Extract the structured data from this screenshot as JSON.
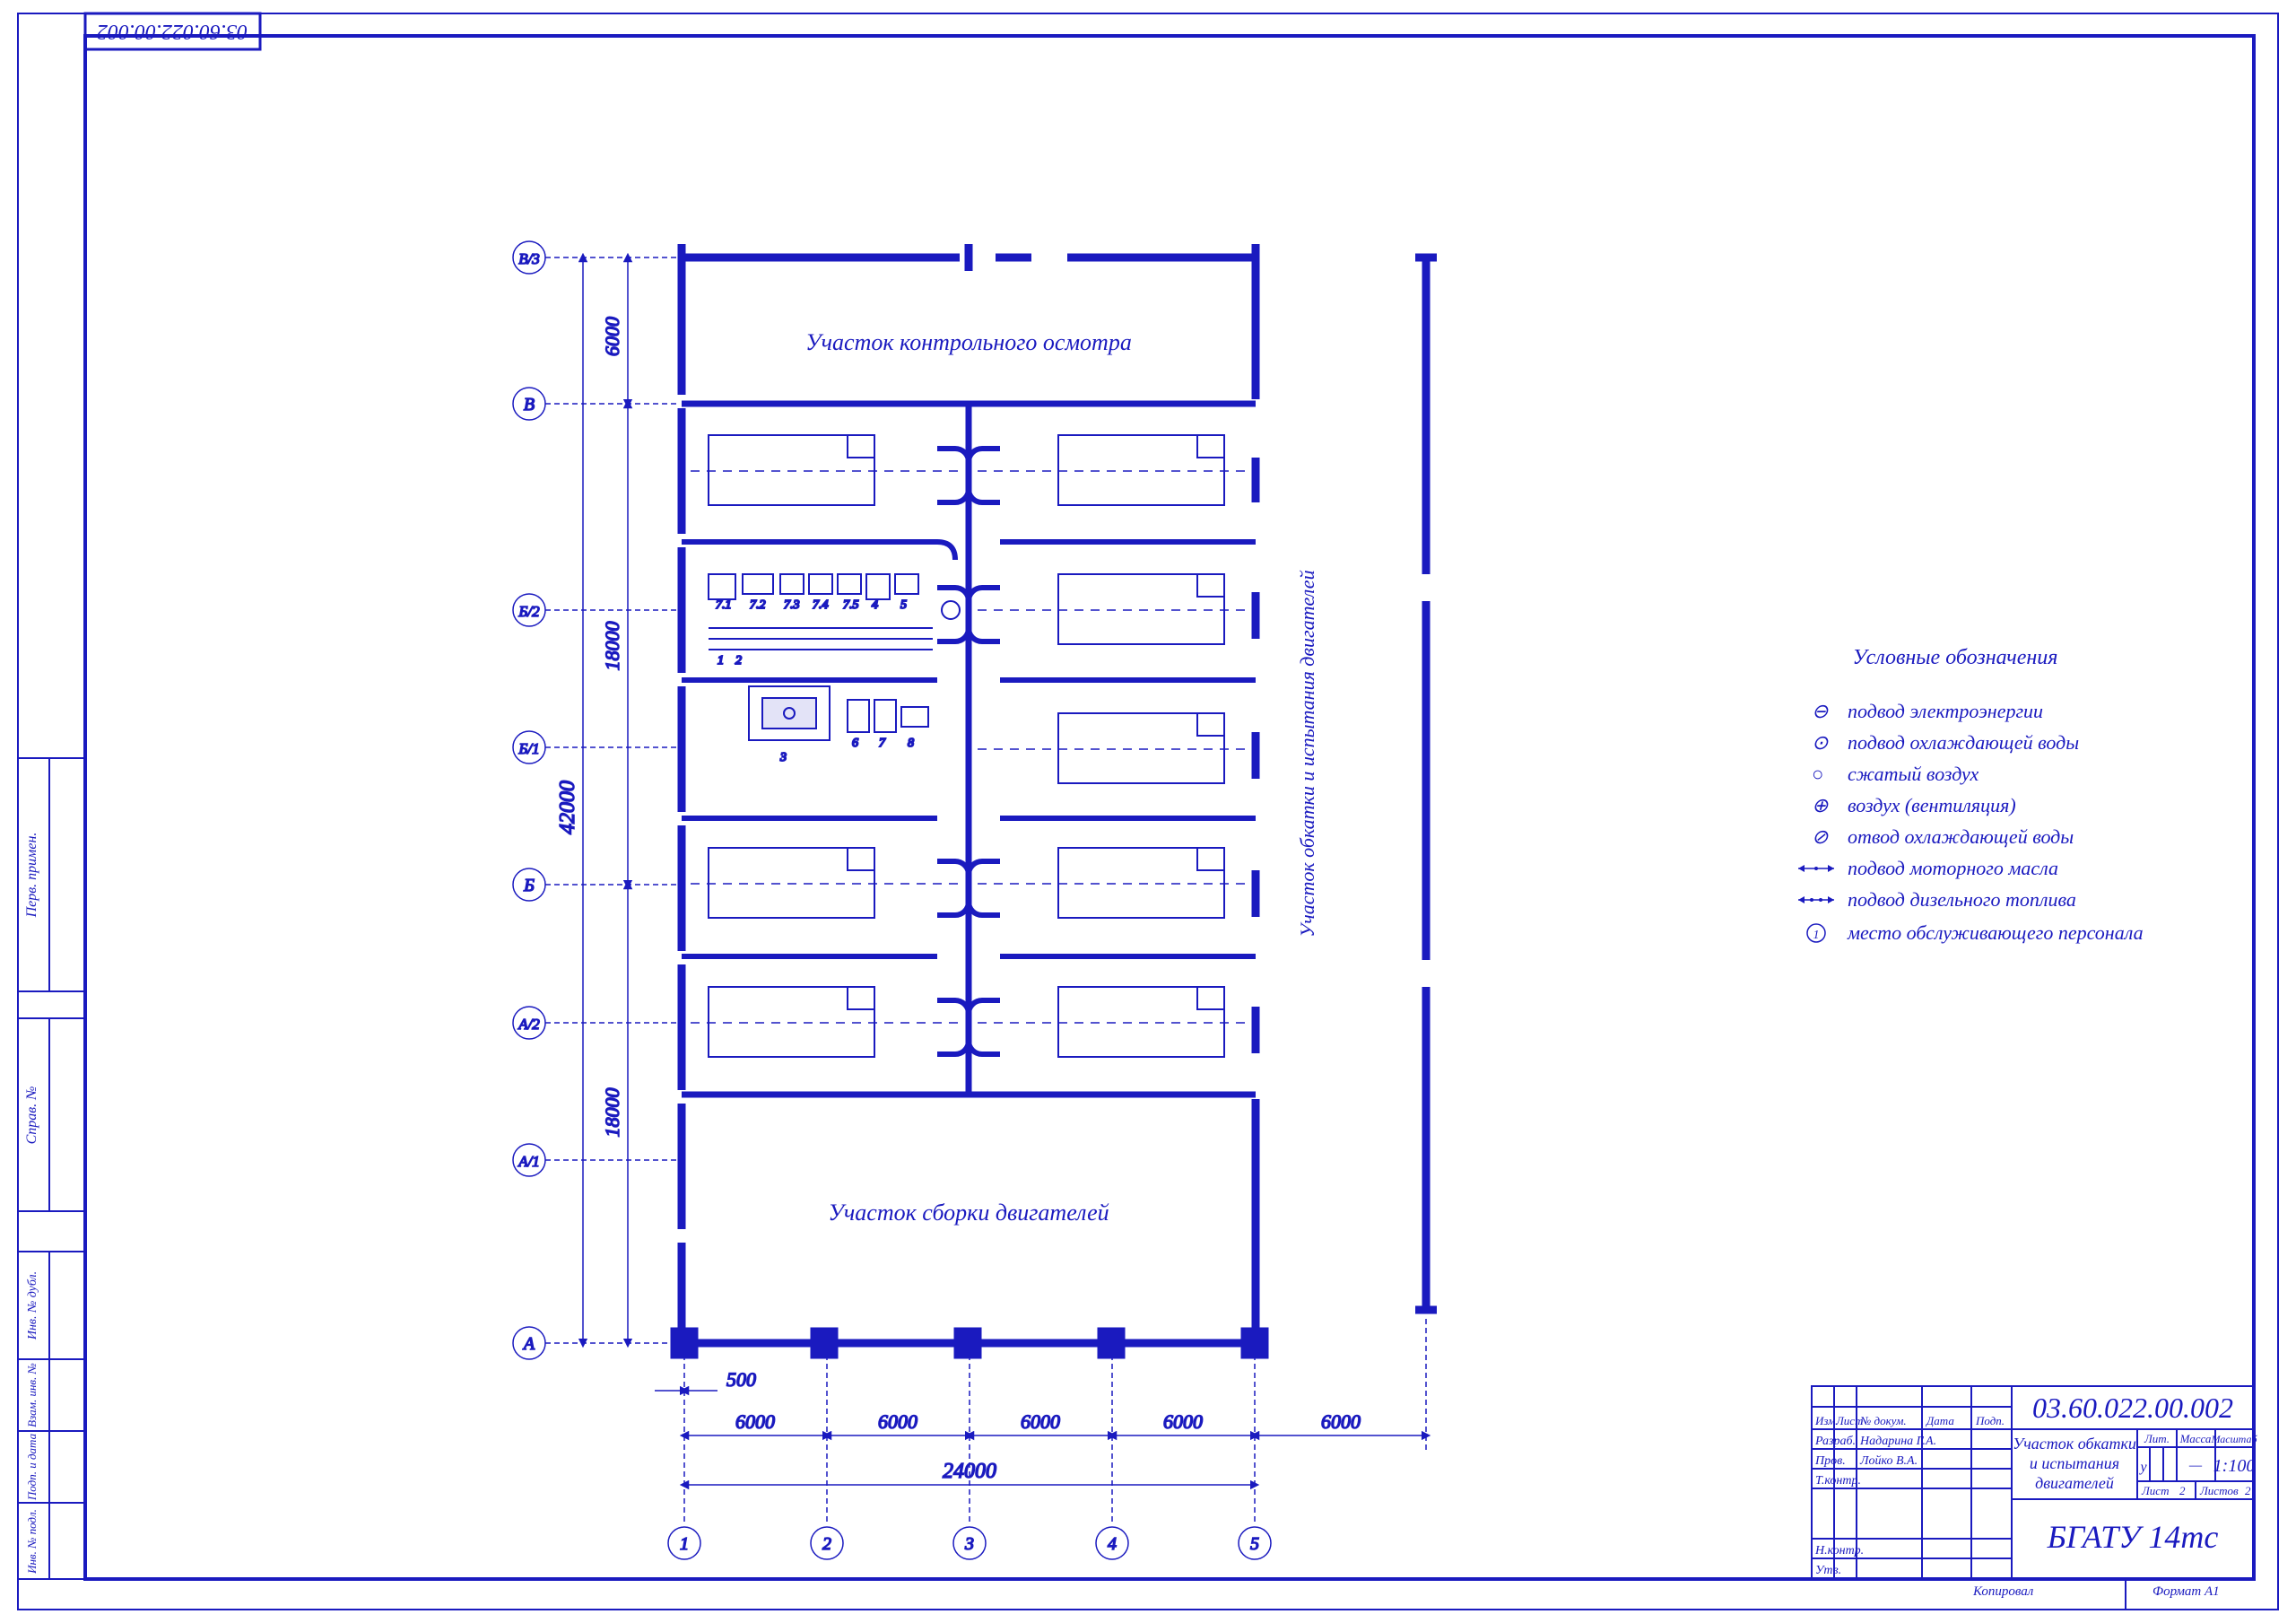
{
  "drawing_number": "03.60.022.00.002",
  "drawing_number_mirrored": "03.60.022.00.002",
  "areas": {
    "inspection": "Участок контрольного осмотра",
    "testing_side": "Участок обкатки и испытания двигателей",
    "assembly": "Участок сборки двигателей"
  },
  "legend": {
    "title": "Условные обозначения",
    "items": [
      {
        "sym": "⊖",
        "label": "подвод электроэнергии"
      },
      {
        "sym": "⊙",
        "label": "подвод охлаждающей воды"
      },
      {
        "sym": "○",
        "label": "сжатый воздух"
      },
      {
        "sym": "⊕",
        "label": "воздух (вентиляция)"
      },
      {
        "sym": "⊘",
        "label": "отвод охлаждающей воды"
      },
      {
        "sym": "→·←",
        "label": "подвод моторного масла"
      },
      {
        "sym": "→··←",
        "label": "подвод дизельного топлива"
      },
      {
        "sym": "①",
        "label": "место обслуживающего персонала"
      }
    ]
  },
  "axes": {
    "vertical_labels": [
      "В/3",
      "В",
      "Б/2",
      "Б/1",
      "Б",
      "А/2",
      "А/1",
      "А"
    ],
    "horizontal_labels": [
      "1",
      "2",
      "3",
      "4",
      "5"
    ]
  },
  "dimensions": {
    "left_first": "500",
    "bottom_spans": [
      "6000",
      "6000",
      "6000",
      "6000"
    ],
    "bottom_total": "24000",
    "side_spans_top": "6000",
    "side_spans_mid": "18000",
    "total_height": "42000",
    "side_spans_bottom": "18000"
  },
  "equipment_labels": [
    "1",
    "2",
    "3",
    "4",
    "5",
    "6",
    "7",
    "7.1",
    "7.2",
    "7.3",
    "7.4",
    "7.5",
    "8"
  ],
  "title_block": {
    "code": "03.60.022.00.002",
    "title_line1": "Участок обкатки",
    "title_line2": "и испытания",
    "title_line3": "двигателей",
    "org": "БГАТУ 14тс",
    "headers": {
      "izm": "Изм.",
      "list": "Лист",
      "ndoc": "№ докум.",
      "podp": "Подп.",
      "data": "Дата"
    },
    "roles": {
      "razrab": "Разраб.",
      "prov": "Пров.",
      "tkontr": "Т.контр.",
      "nkontr": "Н.контр.",
      "utv": "Утв."
    },
    "names": {
      "razrab": "Надарина Г.А.",
      "prov": "Лойко В.А."
    },
    "cols": {
      "lit": "Лит.",
      "massa": "Масса",
      "scale": "Масштаб"
    },
    "scale": "1:100",
    "massa": "—",
    "lit": "у",
    "list_label": "Лист",
    "list_val": "2",
    "listov_label": "Листов",
    "listov_val": "2",
    "format_label": "Формат",
    "format_val": "А1",
    "kopiroval": "Копировал"
  },
  "side_strip": {
    "blocks": [
      "Перв. примен.",
      "Справ. №",
      "Подп. и дата",
      "Инв. № дубл.",
      "Взам. инв. №",
      "Инв. № подл.",
      "Подп. и дата"
    ]
  }
}
